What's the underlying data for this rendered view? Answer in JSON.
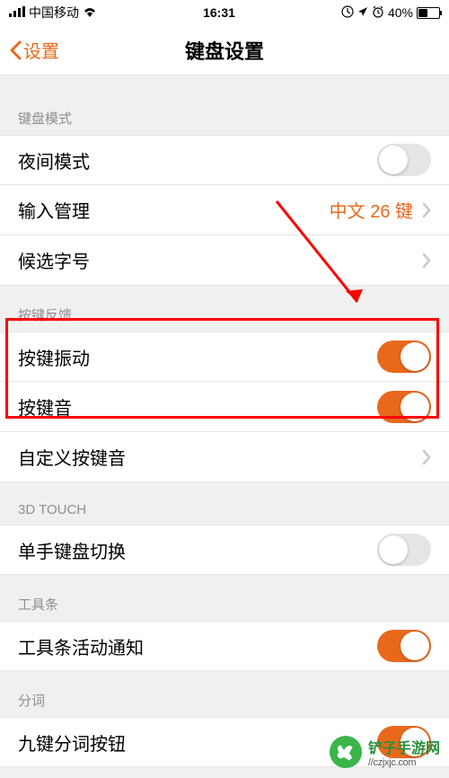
{
  "status_bar": {
    "carrier": "中国移动",
    "time": "16:31",
    "battery_pct": "40%",
    "battery_level": 40
  },
  "nav": {
    "back_label": "设置",
    "title": "键盘设置"
  },
  "sections": {
    "keyboard_mode": {
      "header": "键盘模式",
      "night_mode": "夜间模式",
      "input_management": "输入管理",
      "input_management_value": "中文 26 键",
      "candidate_size": "候选字号"
    },
    "key_feedback": {
      "header": "按键反馈",
      "key_vibration": "按键振动",
      "key_sound": "按键音",
      "custom_sound": "自定义按键音"
    },
    "three_d_touch": {
      "header": "3D TOUCH",
      "one_hand": "单手键盘切换"
    },
    "toolbar": {
      "header": "工具条",
      "activity_notify": "工具条活动通知"
    },
    "segmentation": {
      "header": "分词",
      "nine_key": "九键分词按钮"
    }
  },
  "watermark": {
    "name": "铲子手游网",
    "url": "//czjxjc.com"
  },
  "colors": {
    "accent": "#E8691C",
    "highlight": "#FF0000"
  }
}
